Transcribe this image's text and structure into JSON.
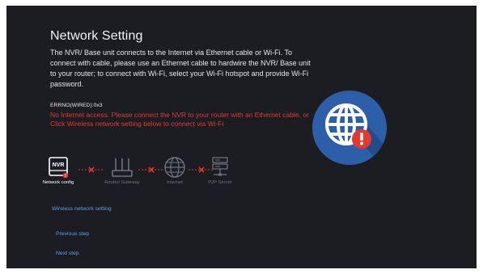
{
  "page": {
    "title": "Network Setting",
    "description": "The NVR/ Base unit connects to the Internet via Ethernet cable or Wi-Fi. To connect with cable, please use an Ethernet cable to hardwire the NVR/ Base unit to your router; to connect with Wi-Fi, select your Wi-Fi hotspot and provide Wi-Fi password.",
    "error_code": "ERRNO(WIRED):0x3",
    "error_message": "No Internet access. Please connect the NVR to your router with an Ethernet cable, or Click Wireless network setting below to connect via Wi-Fi"
  },
  "diagram": {
    "nodes": [
      {
        "label": "Network config",
        "icon": "nvr-icon",
        "text": "NVR",
        "active": true
      },
      {
        "label": "Router/ Gateway",
        "icon": "router-icon",
        "active": false
      },
      {
        "label": "Internet",
        "icon": "globe-icon",
        "active": false
      },
      {
        "label": "P2P Server",
        "icon": "server-icon",
        "active": false
      }
    ],
    "link_status": [
      "disconnected",
      "disconnected",
      "disconnected"
    ],
    "colors": {
      "error": "#e5382f",
      "inactive": "#6e7380",
      "active": "#ffffff"
    }
  },
  "actions": {
    "wireless": "Wireless network setting",
    "previous": "Previous step",
    "next": "Next step"
  },
  "illustration": {
    "icon": "globe-error-icon",
    "circle_color": "#2d5fa8",
    "badge_color": "#e5382f"
  }
}
